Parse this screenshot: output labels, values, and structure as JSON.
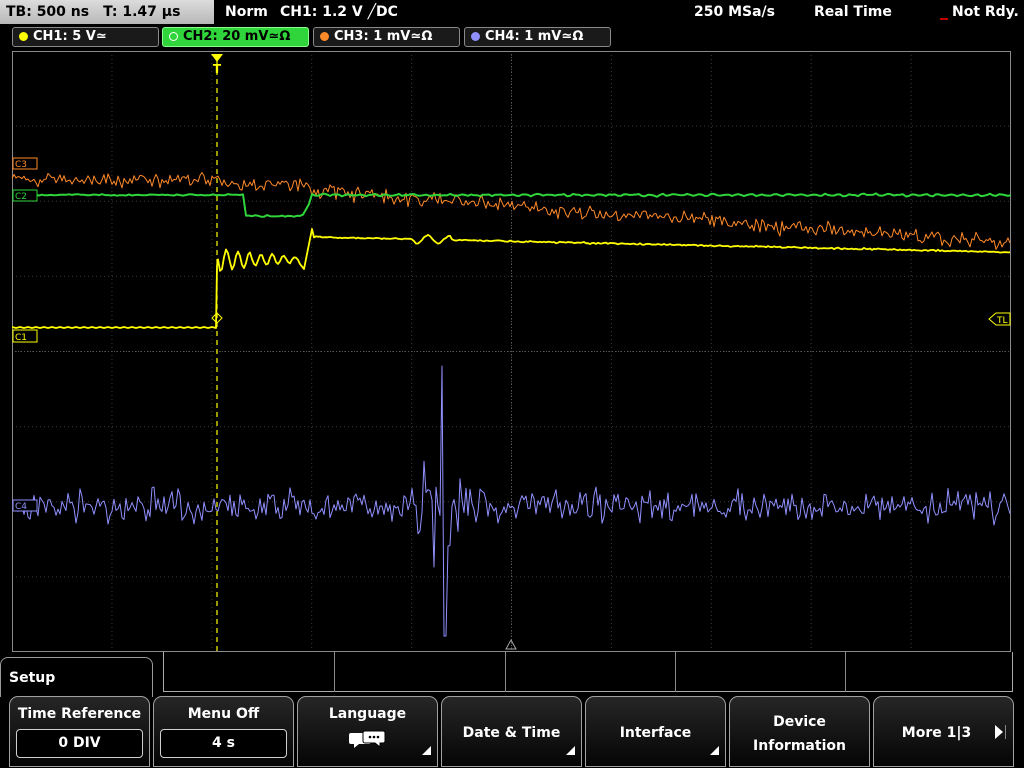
{
  "status": {
    "timebase": "TB: 500 ns",
    "time": "T: 1.47 µs",
    "mode": "Norm",
    "trigger": "CH1: 1.2 V ╱DC",
    "sample_rate": "250 MSa/s",
    "acquisition": "Real Time",
    "ready": "Not Rdy."
  },
  "channels": [
    {
      "label": "CH1: 5 V≃",
      "color": "#ffff00",
      "active": false
    },
    {
      "label": "CH2: 20 mV≃Ω",
      "color": "#2fd53a",
      "active": true
    },
    {
      "label": "CH3: 1 mV≃Ω",
      "color": "#ff8a2a",
      "active": false
    },
    {
      "label": "CH4: 1 mV≃Ω",
      "color": "#9090ff",
      "active": false
    }
  ],
  "markers": {
    "ch3_ref": "C3",
    "ch2_ref": "C2",
    "ch1_ref": "C1",
    "ch4_ref": "C4",
    "trigger_level": "TL",
    "trigger_pos": "T"
  },
  "menu": {
    "setup_title": "Setup",
    "softkeys": [
      {
        "label": "Time Reference",
        "value": "0 DIV"
      },
      {
        "label": "Menu Off",
        "value": "4 s"
      },
      {
        "label": "Language",
        "icon": "speech-bubbles-icon"
      },
      {
        "label": "Date & Time"
      },
      {
        "label": "Interface"
      },
      {
        "label_line1": "Device",
        "label_line2": "Information"
      },
      {
        "label": "More 1|3"
      }
    ]
  },
  "colors": {
    "ch1": "#ffff00",
    "ch2": "#2fd53a",
    "ch3": "#ff8a2a",
    "ch4": "#9090ff",
    "grid": "#3a3a3a"
  }
}
